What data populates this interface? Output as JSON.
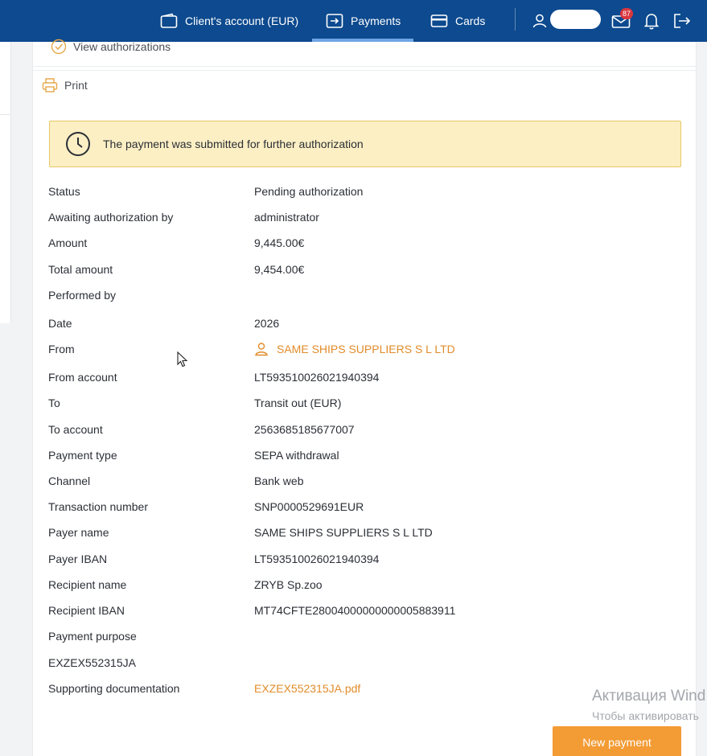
{
  "nav": {
    "items": [
      {
        "label": "Client's account (EUR)",
        "icon": "wallet-icon"
      },
      {
        "label": "Payments",
        "icon": "transfer-icon",
        "active": true
      },
      {
        "label": "Cards",
        "icon": "card-icon"
      }
    ],
    "mail_badge": "87",
    "accent_color": "#0d4a8f"
  },
  "actions": {
    "view_authorizations": "View authorizations",
    "print": "Print"
  },
  "alert": {
    "text": "The payment was submitted for further authorization",
    "icon": "clock-icon"
  },
  "details": [
    {
      "label": "Status",
      "value": "Pending authorization"
    },
    {
      "label": "Awaiting authorization by",
      "value": "administrator"
    },
    {
      "label": "Amount",
      "value": "9,445.00€"
    },
    {
      "label": "Total amount",
      "value": "9,454.00€"
    },
    {
      "label": "Performed by",
      "value": ""
    },
    {
      "label": "Date",
      "value": "2026"
    },
    {
      "label": "From",
      "value": "SAME SHIPS SUPPLIERS S L LTD"
    },
    {
      "label": "From account",
      "value": "LT593510026021940394"
    },
    {
      "label": "To",
      "value": "Transit out (EUR)"
    },
    {
      "label": "To account",
      "value": "2563685185677007"
    },
    {
      "label": "Payment type",
      "value": "SEPA withdrawal"
    },
    {
      "label": "Channel",
      "value": "Bank web"
    },
    {
      "label": "Transaction number",
      "value": "SNP0000529691EUR"
    },
    {
      "label": "Payer name",
      "value": "SAME SHIPS SUPPLIERS S L LTD"
    },
    {
      "label": "Payer IBAN",
      "value": "LT593510026021940394"
    },
    {
      "label": "Recipient name",
      "value": "ZRYB Sp.zoo"
    },
    {
      "label": "Recipient IBAN",
      "value": "MT74CFTE28004000000000005883911"
    },
    {
      "label": "Payment purpose",
      "value": ""
    },
    {
      "label": "EXZEX552315JA",
      "value": ""
    },
    {
      "label": "Supporting documentation",
      "value": "EXZEX552315JA.pdf"
    }
  ],
  "buttons": {
    "new_payment": "New payment"
  },
  "watermark": {
    "line1": "Активация Wind",
    "line2": "Чтобы активировать"
  }
}
